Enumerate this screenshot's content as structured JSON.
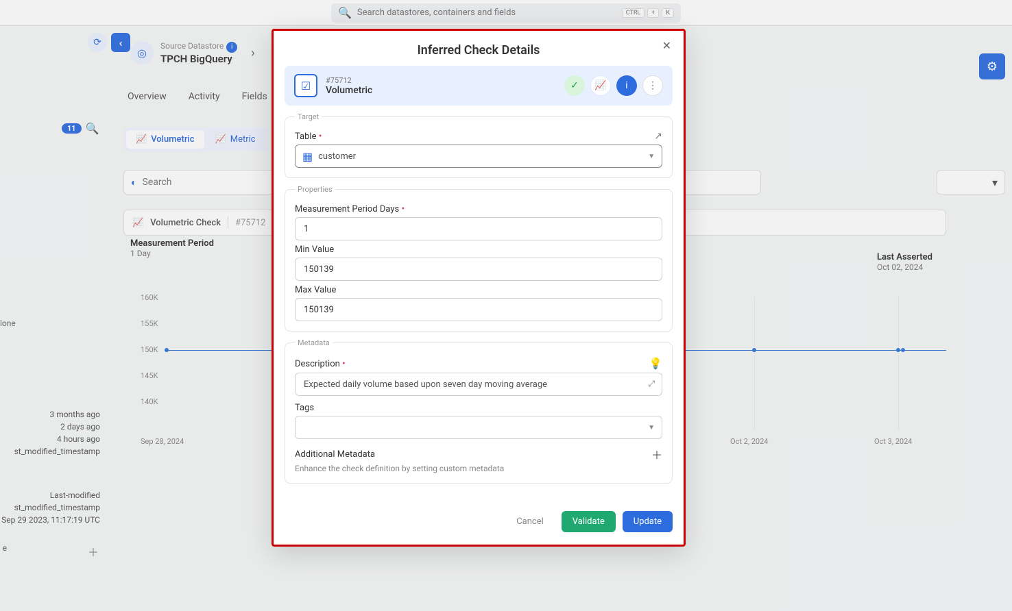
{
  "topbar": {
    "search_placeholder": "Search datastores, containers and fields",
    "kbd_ctrl": "CTRL",
    "kbd_plus": "+",
    "kbd_k": "K"
  },
  "header": {
    "source_label": "Source Datastore",
    "title": "TPCH BigQuery",
    "tabs": {
      "overview": "Overview",
      "activity": "Activity",
      "fields": "Fields"
    }
  },
  "left": {
    "badge_count": "11",
    "done": "lone",
    "ago1": "3 months ago",
    "ago2": "2 days ago",
    "ago3": "4 hours ago",
    "mod_ts1": "st_modified_timestamp",
    "last_mod": "Last-modified",
    "mod_ts2": "st_modified_timestamp",
    "mod_date": "Sep 29 2023, 11:17:19 UTC",
    "e_letter": "e"
  },
  "tabs": {
    "volumetric": "Volumetric",
    "metric": "Metric"
  },
  "search_row": {
    "label": "Search"
  },
  "check_row": {
    "title": "Volumetric Check",
    "id": "#75712"
  },
  "chart": {
    "meas_label": "Measurement Period",
    "meas_value": "1 Day",
    "asserted_label": "Last Asserted",
    "asserted_value": "Oct 02, 2024",
    "y_160": "160K",
    "y_155": "155K",
    "y_150": "150K",
    "y_145": "145K",
    "y_140": "140K",
    "x_sep28": "Sep 28, 2024",
    "x_oct2": "Oct 2, 2024",
    "x_oct3": "Oct 3, 2024"
  },
  "modal": {
    "title": "Inferred Check Details",
    "check_id": "#75712",
    "check_name": "Volumetric",
    "target_legend": "Target",
    "table_label": "Table",
    "table_value": "customer",
    "props_legend": "Properties",
    "mpd_label": "Measurement Period Days",
    "mpd_value": "1",
    "min_label": "Min Value",
    "min_value": "150139",
    "max_label": "Max Value",
    "max_value": "150139",
    "meta_legend": "Metadata",
    "desc_label": "Description",
    "desc_value": "Expected daily volume based upon seven day moving average",
    "tags_label": "Tags",
    "addmeta_label": "Additional Metadata",
    "addmeta_sub": "Enhance the check definition by setting custom metadata",
    "cancel": "Cancel",
    "validate": "Validate",
    "update": "Update"
  }
}
